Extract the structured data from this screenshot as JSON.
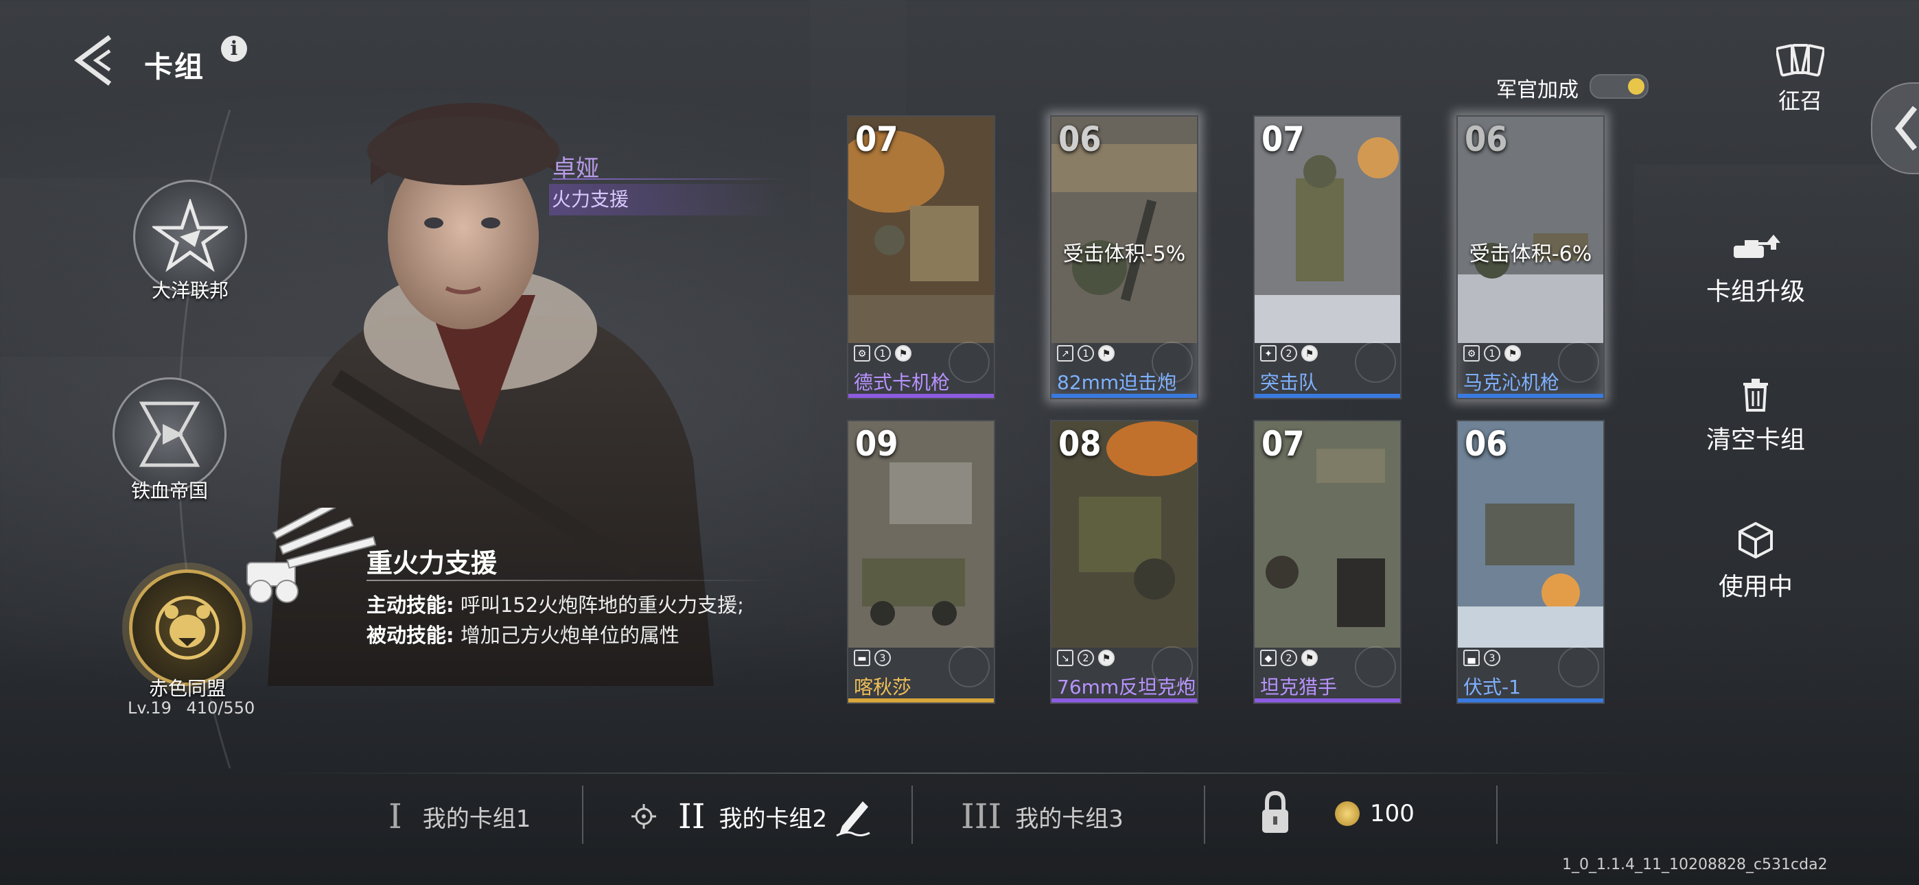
{
  "header": {
    "title": "卡组"
  },
  "factions": [
    {
      "label": "大洋联邦"
    },
    {
      "label": "铁血帝国"
    },
    {
      "label": "赤色同盟",
      "level": "Lv.19",
      "xp": "410/550"
    }
  ],
  "commander": {
    "name": "卓娅",
    "role": "火力支援",
    "skill_title": "重火力支援",
    "active_label": "主动技能:",
    "active_text": "呼叫152火炮阵地的重火力支援;",
    "passive_label": "被动技能:",
    "passive_text": "增加己方火炮单位的属性"
  },
  "officer_bonus": {
    "label": "军官加成"
  },
  "recruit": {
    "label": "征召"
  },
  "cards": [
    {
      "cost": "07",
      "name": "德式卡机枪",
      "count": "1",
      "rarity": "purple",
      "buff": ""
    },
    {
      "cost": "06",
      "name": "82mm迫击炮",
      "count": "1",
      "rarity": "blue",
      "buff": "受击体积-5%"
    },
    {
      "cost": "07",
      "name": "突击队",
      "count": "2",
      "rarity": "blue",
      "buff": ""
    },
    {
      "cost": "06",
      "name": "马克沁机枪",
      "count": "1",
      "rarity": "blue",
      "buff": "受击体积-6%"
    },
    {
      "cost": "09",
      "name": "喀秋莎",
      "count": "3",
      "rarity": "gold",
      "buff": ""
    },
    {
      "cost": "08",
      "name": "76mm反坦克炮",
      "count": "2",
      "rarity": "purple",
      "buff": ""
    },
    {
      "cost": "07",
      "name": "坦克猎手",
      "count": "2",
      "rarity": "purple",
      "buff": ""
    },
    {
      "cost": "06",
      "name": "伏式-1",
      "count": "3",
      "rarity": "blue",
      "buff": ""
    }
  ],
  "menu": {
    "upgrade": "卡组升级",
    "clear": "清空卡组",
    "in_use": "使用中"
  },
  "decks": [
    {
      "num": "I",
      "label": "我的卡组1"
    },
    {
      "num": "II",
      "label": "我的卡组2"
    },
    {
      "num": "III",
      "label": "我的卡组3"
    }
  ],
  "currency": {
    "value": "100"
  },
  "build": "1_0_1.1.4_11_10208828_c531cda2"
}
